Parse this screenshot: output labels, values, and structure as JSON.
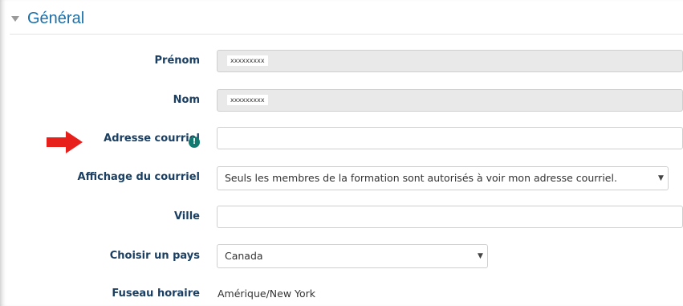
{
  "section": {
    "title": "Général"
  },
  "fields": {
    "prenom": {
      "label": "Prénom",
      "value": "xxxxxxxxx"
    },
    "nom": {
      "label": "Nom",
      "value": "xxxxxxxxx"
    },
    "email": {
      "label": "Adresse courriel",
      "value": ""
    },
    "email_display": {
      "label": "Affichage du courriel",
      "value": "Seuls les membres de la formation sont autorisés à voir mon adresse courriel."
    },
    "ville": {
      "label": "Ville",
      "value": ""
    },
    "pays": {
      "label": "Choisir un pays",
      "value": "Canada"
    },
    "timezone": {
      "label": "Fuseau horaire",
      "value": "Amérique/New York"
    }
  },
  "icons": {
    "collapse": "chevron-down-icon",
    "info": "info-icon",
    "annotation": "red-arrow-icon",
    "select_arrow": "caret-down-icon"
  },
  "colors": {
    "title": "#1a6fab",
    "label": "#1a3f62",
    "info_icon": "#107a70",
    "annotation_arrow": "#e8201b",
    "readonly_field": "#e9e9e9"
  }
}
